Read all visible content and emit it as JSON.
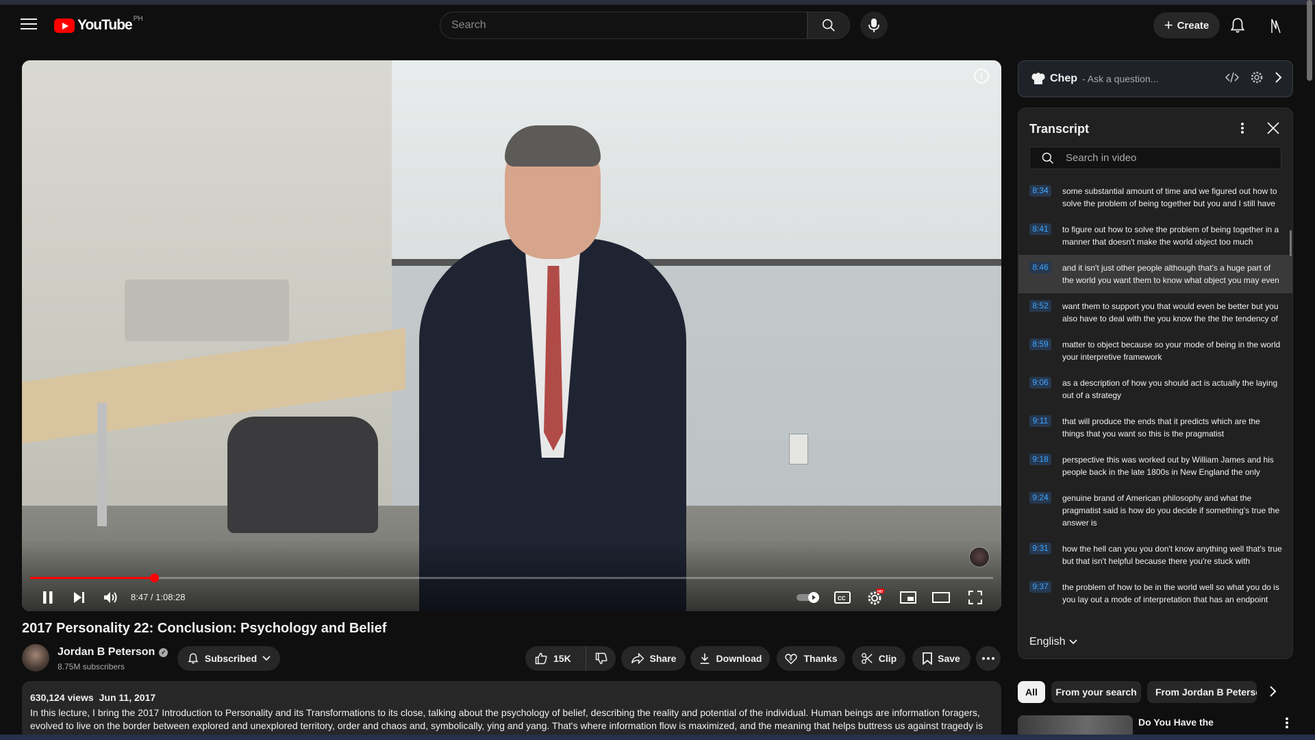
{
  "masthead": {
    "logo_word": "YouTube",
    "country": "PH",
    "search_placeholder": "Search",
    "create_label": "Create"
  },
  "player": {
    "current_time": "8:47",
    "duration": "1:08:28",
    "time_display": "8:47 / 1:08:28",
    "progress_fraction": 0.1284
  },
  "video": {
    "title": "2017 Personality 22: Conclusion: Psychology and Belief",
    "channel_name": "Jordan B Peterson",
    "subscribers": "8.75M subscribers",
    "subscribed_label": "Subscribed",
    "likes": "15K",
    "share_label": "Share",
    "download_label": "Download",
    "thanks_label": "Thanks",
    "clip_label": "Clip",
    "save_label": "Save",
    "views": "630,124 views",
    "date": "Jun 11, 2017",
    "description": "In this lecture, I bring the 2017 Introduction to Personality and its Transformations to its close, talking about the psychology of belief, describing the reality and potential of the individual. Human beings are information foragers, evolved to live on the border between explored and unexplored territory, order and chaos and, symbolically, ying and yang. That's where information flow is maximized, and the meaning that helps buttress us against tragedy is to be found."
  },
  "chep": {
    "name": "Chep",
    "ask": "- Ask a question..."
  },
  "transcript": {
    "title": "Transcript",
    "search_placeholder": "Search in video",
    "language": "English",
    "segments": [
      {
        "time": "8:34",
        "text": "some substantial amount of time and we figured out how to solve the problem of being together but you and I still have"
      },
      {
        "time": "8:41",
        "text": "to figure out how to solve the problem of being together in a manner that doesn't make the world object too much"
      },
      {
        "time": "8:46",
        "text": "and it isn't just other people although that's a huge part of the world you want them to know what object you may even",
        "active": true
      },
      {
        "time": "8:52",
        "text": "want them to support you that would even be better but you also have to deal with the you know the the the tendency of"
      },
      {
        "time": "8:59",
        "text": "matter to object because so your mode of being in the world your interpretive framework"
      },
      {
        "time": "9:06",
        "text": "as a description of how you should act is actually the laying out of a strategy"
      },
      {
        "time": "9:11",
        "text": "that will produce the ends that it predicts which are the things that you want so this is the pragmatist"
      },
      {
        "time": "9:18",
        "text": "perspective this was worked out by William James and his people back in the late 1800s in New England the only"
      },
      {
        "time": "9:24",
        "text": "genuine brand of American philosophy and what the pragmatist said is how do you decide if something's true the answer is"
      },
      {
        "time": "9:31",
        "text": "how the hell can you you don't know anything well that's true but that isn't helpful because there you're stuck with"
      },
      {
        "time": "9:37",
        "text": "the problem of how to be in the world well so what you do is you lay out a mode of interpretation that has an endpoint"
      }
    ]
  },
  "chips": [
    "All",
    "From your search",
    "From Jordan B Peterson"
  ],
  "recommendation": {
    "title": "Do You Have the"
  },
  "colors": {
    "accent_red": "#ff0000",
    "timestamp_blue": "#3ea6ff",
    "background": "#0f0f0f"
  }
}
